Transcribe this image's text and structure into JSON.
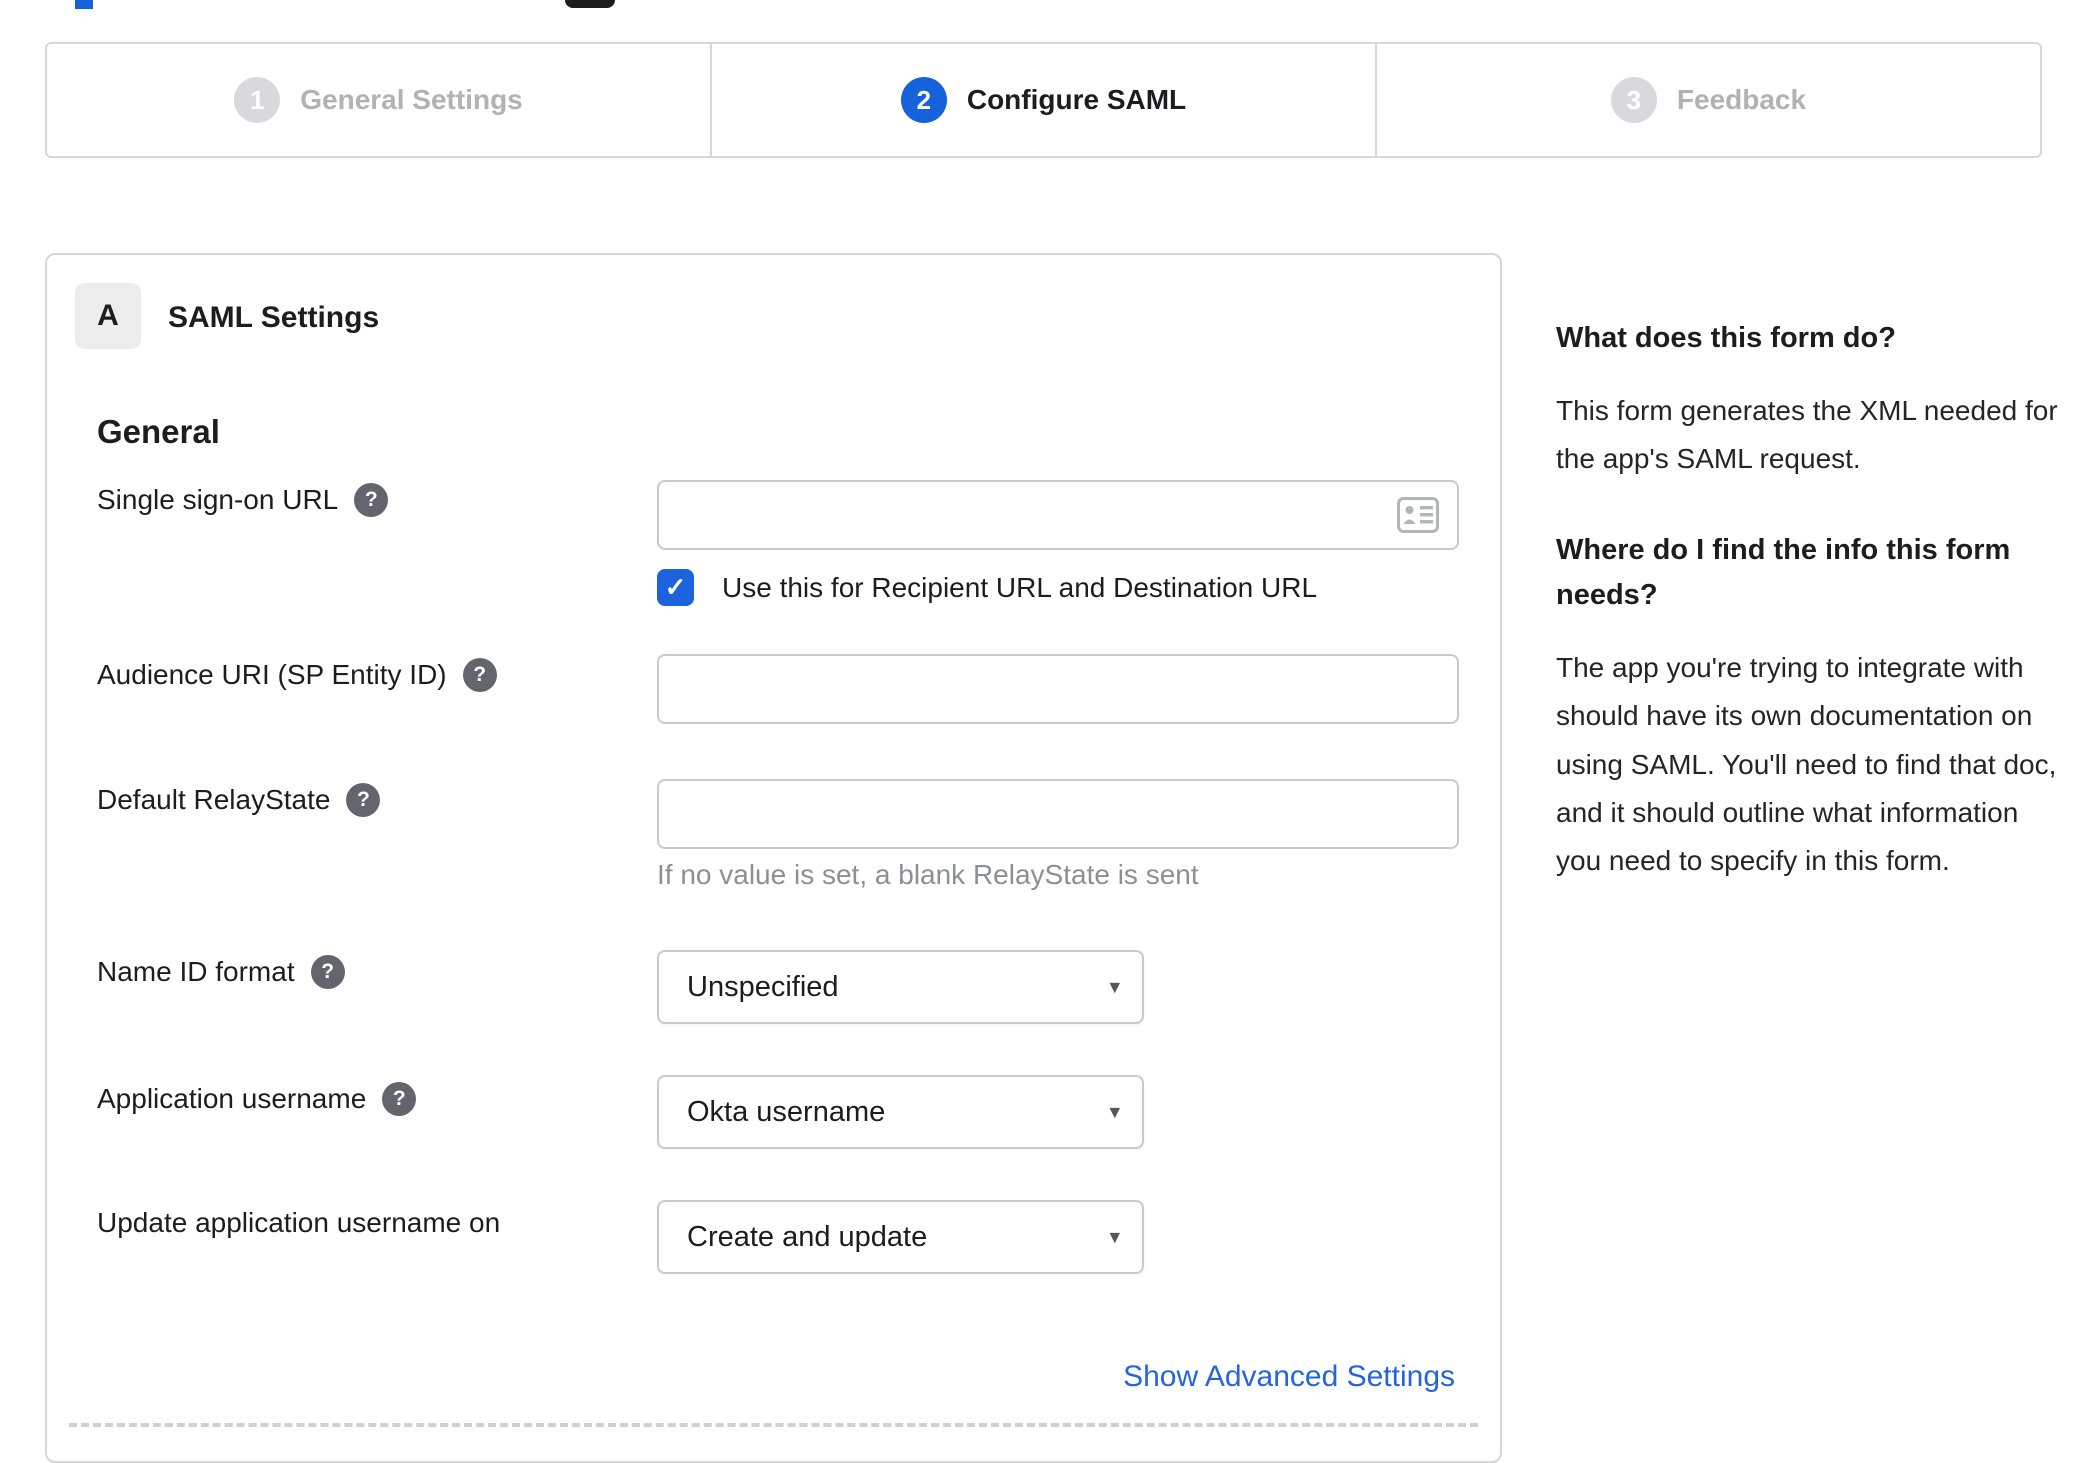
{
  "icons": {
    "help": "?",
    "caret": "▾",
    "check": "✓"
  },
  "stepper": {
    "steps": [
      {
        "number": "1",
        "label": "General Settings",
        "state": "inactive"
      },
      {
        "number": "2",
        "label": "Configure SAML",
        "state": "active"
      },
      {
        "number": "3",
        "label": "Feedback",
        "state": "inactive"
      }
    ]
  },
  "panel": {
    "badge": "A",
    "title": "SAML Settings",
    "section_title": "General",
    "fields": {
      "sso_url": {
        "label": "Single sign-on URL",
        "value": ""
      },
      "sso_checkbox": {
        "label": "Use this for Recipient URL and Destination URL",
        "checked": true
      },
      "audience_uri": {
        "label": "Audience URI (SP Entity ID)",
        "value": ""
      },
      "default_relay_state": {
        "label": "Default RelayState",
        "value": "",
        "hint": "If no value is set, a blank RelayState is sent"
      },
      "name_id_format": {
        "label": "Name ID format",
        "value": "Unspecified"
      },
      "application_username": {
        "label": "Application username",
        "value": "Okta username"
      },
      "update_application_username_on": {
        "label": "Update application username on",
        "value": "Create and update"
      }
    },
    "advanced_link": "Show Advanced Settings"
  },
  "sidebar": {
    "sections": [
      {
        "heading": "What does this form do?",
        "body": "This form generates the XML needed for the app's SAML request."
      },
      {
        "heading": "Where do I find the info this form needs?",
        "body": "The app you're trying to integrate with should have its own documentation on using SAML. You'll need to find that doc, and it should outline what information you need to specify in this form."
      }
    ]
  },
  "colors": {
    "accent_blue": "#1662dd",
    "link_blue": "#2465dd",
    "text_dark": "#1d1d21",
    "inactive_gray": "#b1b1b6",
    "border_gray": "#d6d6db",
    "input_border_gray": "#c9c9cf",
    "help_icon_gray": "#64646d",
    "hint_gray": "#8e8e97"
  }
}
